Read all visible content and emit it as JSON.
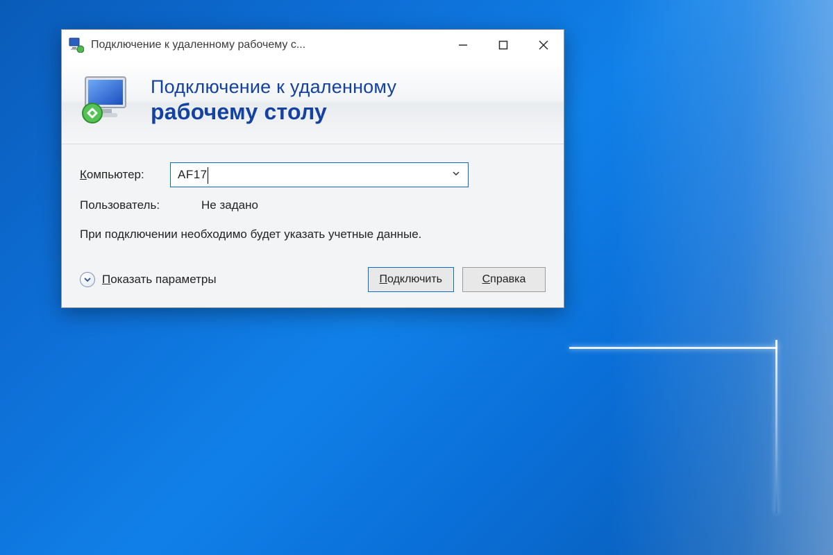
{
  "titlebar": {
    "title": "Подключение к удаленному рабочему с..."
  },
  "banner": {
    "line1": "Подключение к удаленному",
    "line2": "рабочему столу"
  },
  "form": {
    "computer_label_underlined": "К",
    "computer_label_rest": "омпьютер:",
    "computer_value": "AF17",
    "user_label": "Пользователь:",
    "user_value": "Не задано",
    "hint": "При подключении необходимо будет указать учетные данные."
  },
  "footer": {
    "show_options_u": "П",
    "show_options_rest": "оказать параметры",
    "connect_u": "П",
    "connect_rest": "одключить",
    "help_u": "С",
    "help_rest": "правка"
  }
}
